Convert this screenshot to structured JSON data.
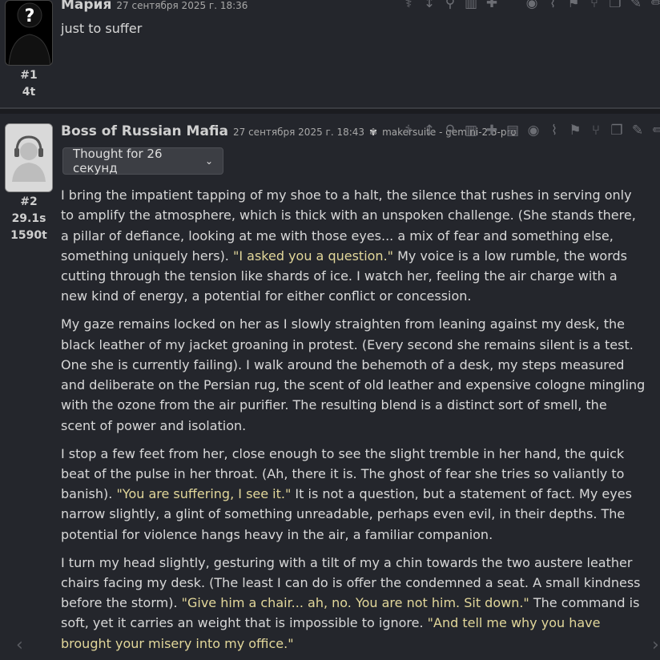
{
  "messages": [
    {
      "author": "Мария",
      "date": "27 сентября 2025 г. 18:36",
      "index": "#1",
      "tokens": "4t",
      "text": "just to suffer"
    },
    {
      "author": "Boss of Russian Mafia",
      "date": "27 сентября 2025 г. 18:43",
      "model_icon": "butterfly-icon",
      "model": "makersuite - gemini-2.5-pro",
      "index": "#2",
      "time": "29.1s",
      "tokens": "1590t",
      "thought_label": "Thought for 26 секунд",
      "paragraphs": [
        {
          "before": "I bring the impatient tapping of my shoe to a halt, the silence that rushes in serving only to amplify the atmosphere, which is thick with an unspoken challenge. (She stands there, a pillar of defiance, looking at me with those eyes... a mix of fear and something else, something uniquely hers). ",
          "quote": "\"I asked you a question.\"",
          "after": " My voice is a low rumble, the words cutting through the tension like shards of ice. I watch her, feeling the air charge with a new kind of energy, a potential for either conflict or concession."
        },
        {
          "before": "My gaze remains locked on her as I slowly straighten from leaning against my desk, the black leather of my jacket groaning in protest. (Every second she remains silent is a test. One she is currently failing). I walk around the behemoth of a desk, my steps measured and deliberate on the Persian rug, the scent of old leather and expensive cologne mingling with the ozone from the air purifier. The resulting blend is a distinct sort of smell, the scent of power and isolation.",
          "quote": "",
          "after": ""
        },
        {
          "before": "I stop a few feet from her, close enough to see the slight tremble in her hand, the quick beat of the pulse in her throat. (Ah, there it is. The ghost of fear she tries so valiantly to banish). ",
          "quote": "\"You are suffering, I see it.\"",
          "after": " It is not a question, but a statement of fact. My eyes narrow slightly, a glint of something unreadable, perhaps even evil, in their depths. The potential for violence hangs heavy in the air, a familiar companion."
        },
        {
          "before": "I turn my head slightly, gesturing with a tilt of my a chin towards the two austere leather chairs facing my desk. (The least I can do is offer the condemned a seat. A small kindness before the storm). ",
          "quote": "\"Give him a chair... ah, no. You are not him. Sit down.\"",
          "after": " The command is soft, yet it carries an weight that is impossible to ignore. ",
          "quote2": "\"And tell me why you have brought your misery into my office.\""
        }
      ]
    }
  ],
  "toolbar_icons": [
    "stethoscope-icon",
    "text-size-icon",
    "wand-icon",
    "trash-icon",
    "puzzle-icon",
    "notes-icon",
    "eye-icon",
    "paperclip-icon",
    "flag-icon",
    "branch-icon",
    "copy-icon",
    "edit-icon",
    "pencil-icon"
  ],
  "nav": {
    "left": "‹",
    "right": "›"
  }
}
